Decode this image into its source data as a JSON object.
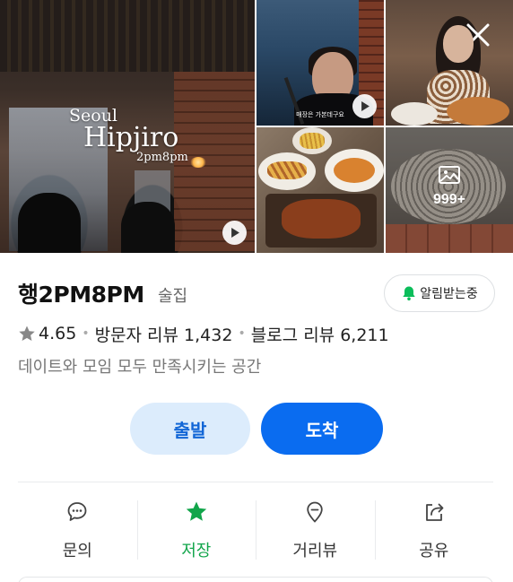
{
  "photos": {
    "main_overlay": {
      "line1": "Seoul",
      "line2": "Hipjiro",
      "line3": "2pm8pm"
    },
    "video_caption": "매장은 가본데구요",
    "more_count": "999+"
  },
  "place": {
    "name": "행2PM8PM",
    "category": "술집",
    "alert_label": "알림받는중",
    "rating": "4.65",
    "visitor_reviews": "방문자 리뷰 1,432",
    "blog_reviews": "블로그 리뷰 6,211",
    "description": "데이트와 모임 모두 만족시키는 공간"
  },
  "cta": {
    "depart": "출발",
    "arrive": "도착"
  },
  "actions": [
    {
      "label": "문의",
      "icon": "chat-bubble-icon"
    },
    {
      "label": "저장",
      "icon": "star-icon",
      "active": true
    },
    {
      "label": "거리뷰",
      "icon": "location-pin-icon"
    },
    {
      "label": "공유",
      "icon": "share-icon"
    }
  ],
  "colors": {
    "accent_blue": "#0a6cf0",
    "save_green": "#11a54a",
    "bell_green": "#0bbd5a"
  }
}
